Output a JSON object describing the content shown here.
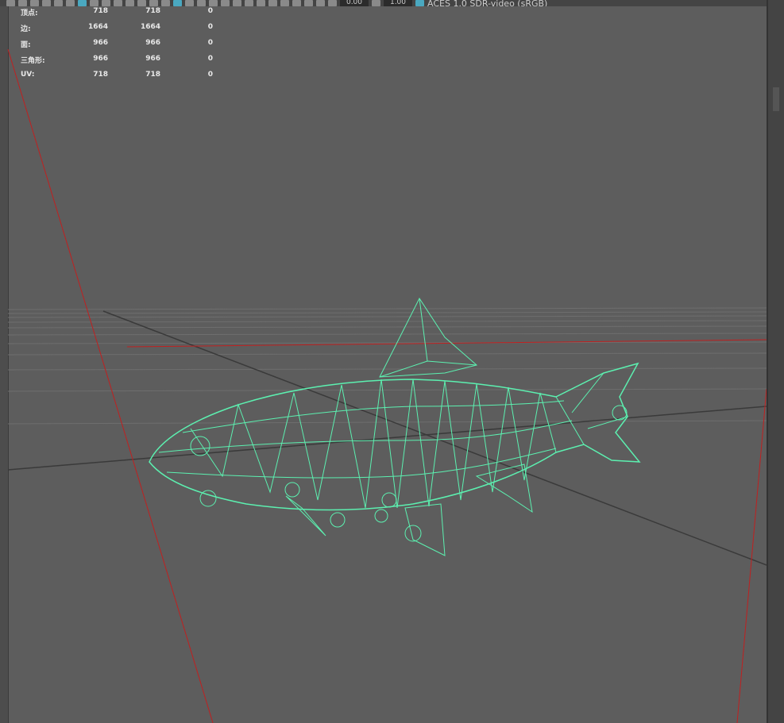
{
  "toolbar": {
    "exposure_value": "0.00",
    "gamma_value": "1.00",
    "color_space": "ACES 1.0 SDR-video (sRGB)"
  },
  "hud": {
    "rows": [
      {
        "label": "顶点:",
        "total": "718",
        "selected": "718",
        "other": "0"
      },
      {
        "label": "边:",
        "total": "1664",
        "selected": "1664",
        "other": "0"
      },
      {
        "label": "面:",
        "total": "966",
        "selected": "966",
        "other": "0"
      },
      {
        "label": "三角形:",
        "total": "966",
        "selected": "966",
        "other": "0"
      },
      {
        "label": "UV:",
        "total": "718",
        "selected": "718",
        "other": "0"
      }
    ]
  },
  "colors": {
    "wireframe": "#5cf0b0",
    "axis": "#c02020",
    "viewport": "#5d5d5d",
    "accent": "#4aa8c0"
  }
}
